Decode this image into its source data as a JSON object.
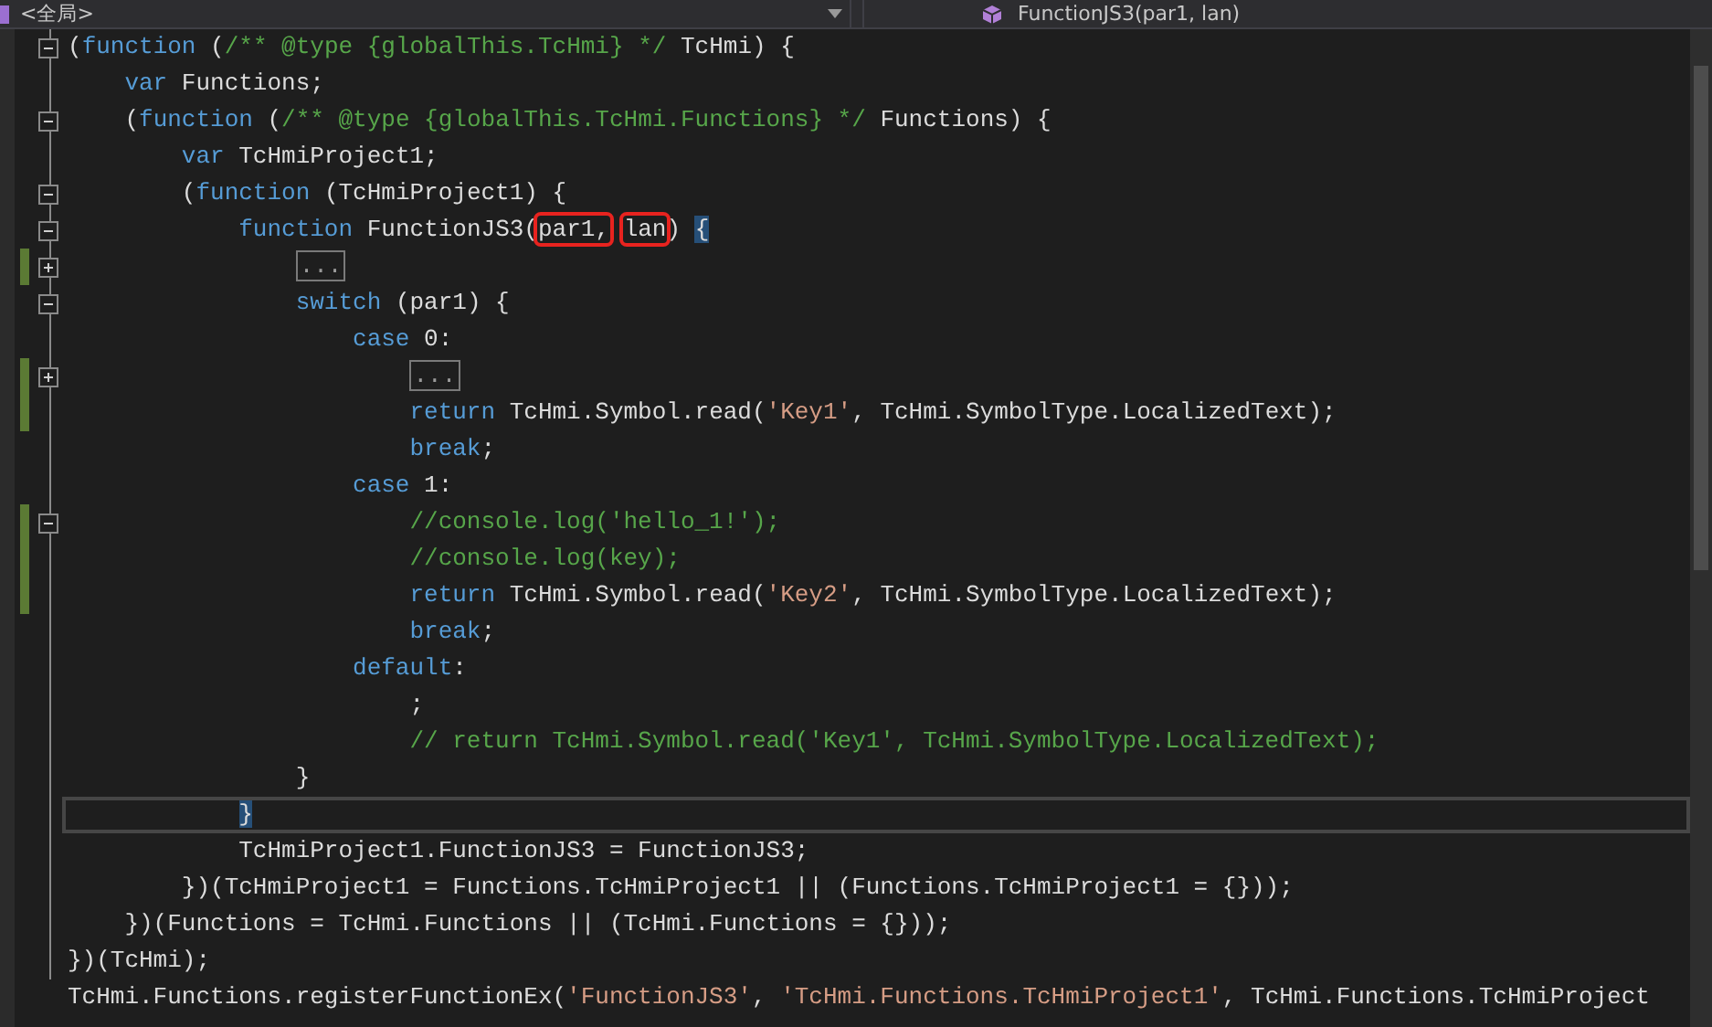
{
  "nav_bar": {
    "scope": "<全局>",
    "member": "FunctionJS3(par1, lan)"
  },
  "lines": [
    {
      "fold_toggle": {
        "expanded": true
      },
      "changed": false,
      "current": false,
      "tokens": [
        {
          "kind": "plain",
          "text": "("
        },
        {
          "kind": "keyword",
          "text": "function"
        },
        {
          "kind": "plain",
          "text": " ("
        },
        {
          "kind": "comment",
          "text": "/** @type {globalThis.TcHmi} */"
        },
        {
          "kind": "plain",
          "text": " TcHmi) {"
        }
      ]
    },
    {
      "changed": false,
      "current": false,
      "tokens": [
        {
          "kind": "keyword",
          "text": "    var"
        },
        {
          "kind": "plain",
          "text": " Functions;"
        }
      ]
    },
    {
      "fold_toggle": {
        "expanded": true
      },
      "changed": false,
      "current": false,
      "tokens": [
        {
          "kind": "plain",
          "text": "    ("
        },
        {
          "kind": "keyword",
          "text": "function"
        },
        {
          "kind": "plain",
          "text": " ("
        },
        {
          "kind": "comment",
          "text": "/** @type {globalThis.TcHmi.Functions} */"
        },
        {
          "kind": "plain",
          "text": " Functions) {"
        }
      ]
    },
    {
      "changed": false,
      "current": false,
      "tokens": [
        {
          "kind": "keyword",
          "text": "        var"
        },
        {
          "kind": "plain",
          "text": " TcHmiProject1;"
        }
      ]
    },
    {
      "fold_toggle": {
        "expanded": true
      },
      "changed": false,
      "current": false,
      "tokens": [
        {
          "kind": "plain",
          "text": "        ("
        },
        {
          "kind": "keyword",
          "text": "function"
        },
        {
          "kind": "plain",
          "text": " (TcHmiProject1) {"
        }
      ]
    },
    {
      "fold_toggle": {
        "expanded": true
      },
      "changed": false,
      "current": false,
      "tokens": [
        {
          "kind": "keyword",
          "text": "            function"
        },
        {
          "kind": "plain",
          "text": " FunctionJS3("
        },
        {
          "kind": "marked",
          "text": "par1,"
        },
        {
          "kind": "marked",
          "text": " lan"
        },
        {
          "kind": "plain",
          "text": ") "
        },
        {
          "kind": "brace",
          "text": "{"
        }
      ]
    },
    {
      "fold_toggle": {
        "expanded": false
      },
      "changed": true,
      "current": false,
      "tokens": [
        {
          "kind": "collapsed",
          "text": "                ..."
        }
      ]
    },
    {
      "fold_toggle": {
        "expanded": true
      },
      "changed": false,
      "current": false,
      "tokens": [
        {
          "kind": "keyword",
          "text": "                switch"
        },
        {
          "kind": "plain",
          "text": " (par1) {"
        }
      ]
    },
    {
      "changed": false,
      "current": false,
      "tokens": [
        {
          "kind": "keyword",
          "text": "                    case"
        },
        {
          "kind": "plain",
          "text": " 0:"
        }
      ]
    },
    {
      "fold_toggle": {
        "expanded": false
      },
      "changed": true,
      "current": false,
      "tokens": [
        {
          "kind": "collapsed",
          "text": "                        ..."
        }
      ]
    },
    {
      "changed": true,
      "current": false,
      "tokens": [
        {
          "kind": "keyword",
          "text": "                        return"
        },
        {
          "kind": "plain",
          "text": " TcHmi.Symbol.read("
        },
        {
          "kind": "string",
          "text": "'Key1'"
        },
        {
          "kind": "plain",
          "text": ", TcHmi.SymbolType.LocalizedText);"
        }
      ]
    },
    {
      "changed": false,
      "current": false,
      "tokens": [
        {
          "kind": "keyword",
          "text": "                        break"
        },
        {
          "kind": "plain",
          "text": ";"
        }
      ]
    },
    {
      "changed": false,
      "current": false,
      "tokens": [
        {
          "kind": "keyword",
          "text": "                    case"
        },
        {
          "kind": "plain",
          "text": " 1:"
        }
      ]
    },
    {
      "fold_toggle": {
        "expanded": true
      },
      "changed": true,
      "current": false,
      "tokens": [
        {
          "kind": "comment",
          "text": "                        //console.log('hello_1!');"
        }
      ]
    },
    {
      "changed": true,
      "current": false,
      "tokens": [
        {
          "kind": "comment",
          "text": "                        //console.log(key);"
        }
      ]
    },
    {
      "changed": true,
      "current": false,
      "tokens": [
        {
          "kind": "keyword",
          "text": "                        return"
        },
        {
          "kind": "plain",
          "text": " TcHmi.Symbol.read("
        },
        {
          "kind": "string",
          "text": "'Key2'"
        },
        {
          "kind": "plain",
          "text": ", TcHmi.SymbolType.LocalizedText);"
        }
      ]
    },
    {
      "changed": false,
      "current": false,
      "tokens": [
        {
          "kind": "keyword",
          "text": "                        break"
        },
        {
          "kind": "plain",
          "text": ";"
        }
      ]
    },
    {
      "changed": false,
      "current": false,
      "tokens": [
        {
          "kind": "keyword",
          "text": "                    default"
        },
        {
          "kind": "plain",
          "text": ":"
        }
      ]
    },
    {
      "changed": false,
      "current": false,
      "tokens": [
        {
          "kind": "plain",
          "text": "                        ;"
        }
      ]
    },
    {
      "changed": false,
      "current": false,
      "tokens": [
        {
          "kind": "comment",
          "text": "                        // return TcHmi.Symbol.read('Key1', TcHmi.SymbolType.LocalizedText);"
        }
      ]
    },
    {
      "changed": false,
      "current": false,
      "tokens": [
        {
          "kind": "plain",
          "text": "                }"
        }
      ]
    },
    {
      "changed": false,
      "current": true,
      "tokens": [
        {
          "kind": "brace",
          "text": "            }"
        }
      ]
    },
    {
      "changed": false,
      "current": false,
      "tokens": [
        {
          "kind": "plain",
          "text": "            TcHmiProject1.FunctionJS3 = FunctionJS3;"
        }
      ]
    },
    {
      "changed": false,
      "current": false,
      "tokens": [
        {
          "kind": "plain",
          "text": "        })(TcHmiProject1 = Functions.TcHmiProject1 || (Functions.TcHmiProject1 = {}));"
        }
      ]
    },
    {
      "changed": false,
      "current": false,
      "tokens": [
        {
          "kind": "plain",
          "text": "    })(Functions = TcHmi.Functions || (TcHmi.Functions = {}));"
        }
      ]
    },
    {
      "changed": false,
      "current": false,
      "tokens": [
        {
          "kind": "plain",
          "text": "})(TcHmi);"
        }
      ]
    },
    {
      "changed": false,
      "current": false,
      "tokens": [
        {
          "kind": "plain",
          "text": "TcHmi.Functions.registerFunctionEx("
        },
        {
          "kind": "string",
          "text": "'FunctionJS3'"
        },
        {
          "kind": "plain",
          "text": ", "
        },
        {
          "kind": "string",
          "text": "'TcHmi.Functions.TcHmiProject1'"
        },
        {
          "kind": "plain",
          "text": ", TcHmi.Functions.TcHmiProject"
        }
      ]
    }
  ]
}
